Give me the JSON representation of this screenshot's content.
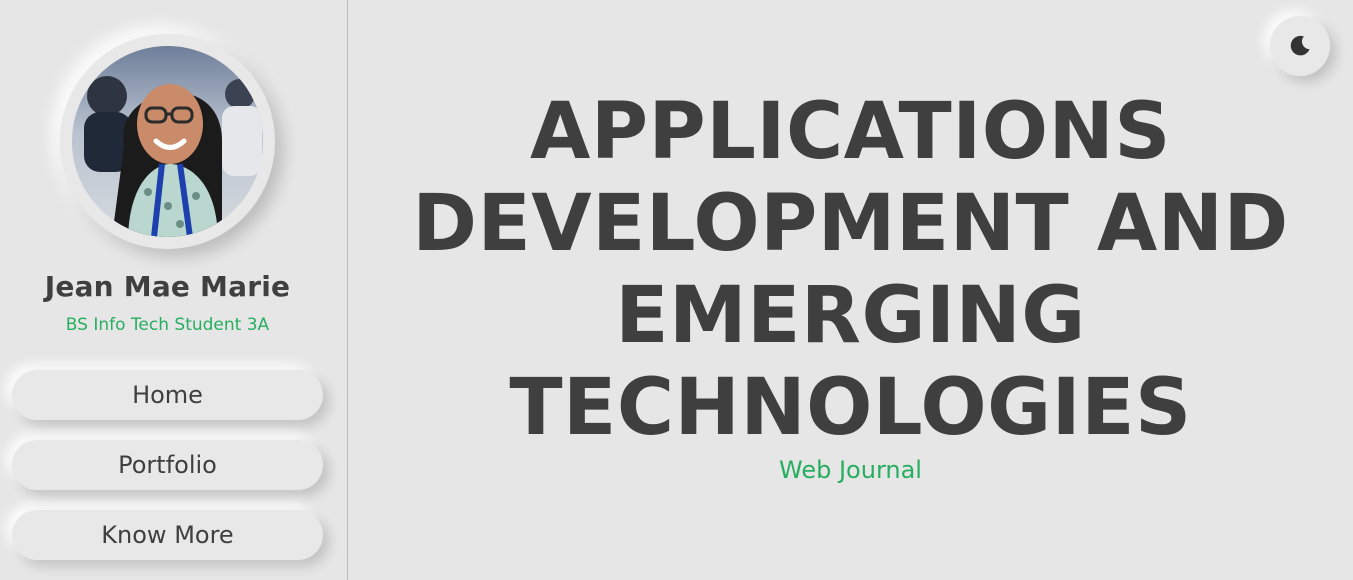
{
  "profile": {
    "name": "Jean Mae Marie",
    "subtitle": "BS Info Tech Student 3A"
  },
  "nav": {
    "items": [
      {
        "label": "Home"
      },
      {
        "label": "Portfolio"
      },
      {
        "label": "Know More"
      }
    ]
  },
  "hero": {
    "title_lines": [
      "APPLICATIONS",
      "DEVELOPMENT AND",
      "EMERGING",
      "TECHNOLOGIES"
    ],
    "subtitle": "Web Journal"
  },
  "icons": {
    "theme_toggle": "moon-icon",
    "avatar": "profile-photo"
  },
  "colors": {
    "background": "#e6e6e6",
    "text": "#3f3f3f",
    "accent": "#27ae60"
  }
}
